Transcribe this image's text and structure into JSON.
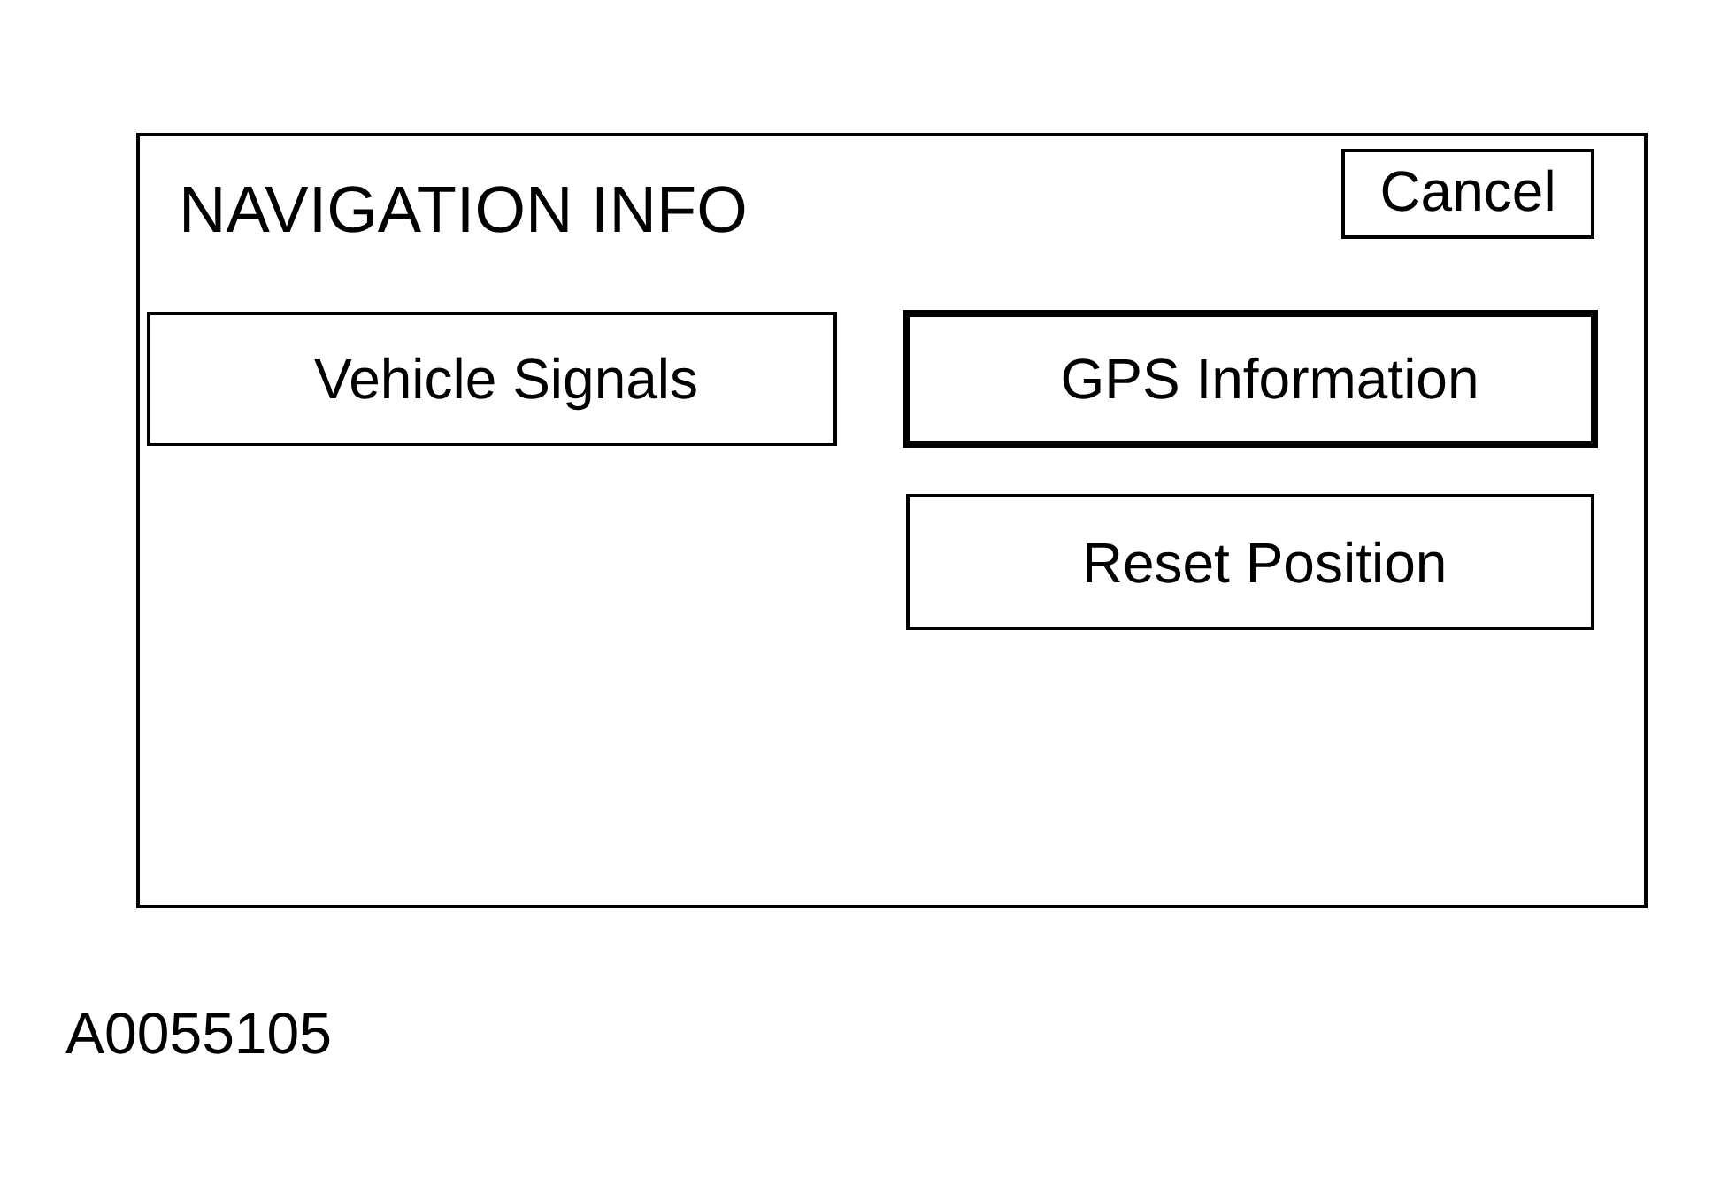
{
  "screen": {
    "title": "NAVIGATION INFO",
    "cancel_button": "Cancel",
    "columns": [
      {
        "buttons": [
          {
            "label": "Vehicle Signals",
            "selected": false
          }
        ]
      },
      {
        "buttons": [
          {
            "label": "GPS Information",
            "selected": true
          },
          {
            "label": "Reset Position",
            "selected": false
          }
        ]
      }
    ]
  },
  "figure_id": "A0055105"
}
